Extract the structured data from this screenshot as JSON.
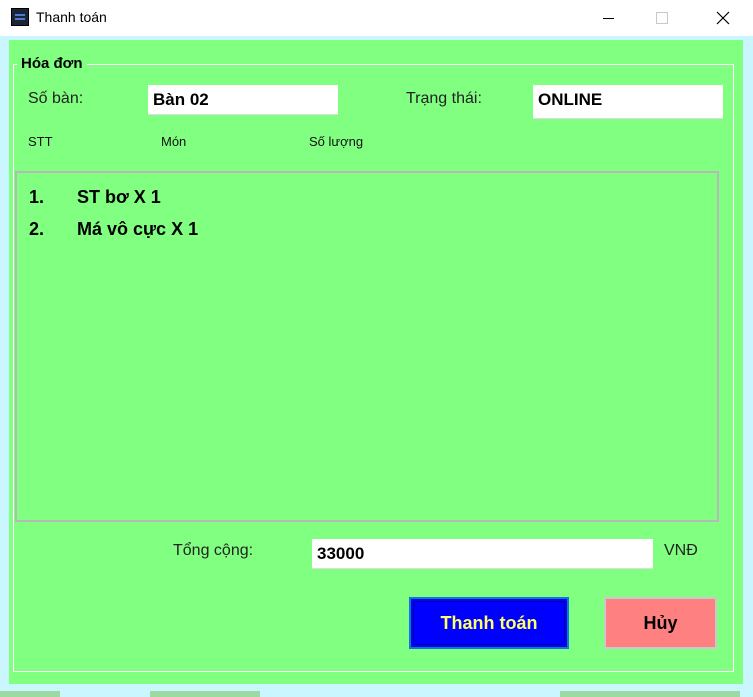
{
  "window": {
    "title": "Thanh toán",
    "controls": {
      "minimize": "minimize-icon",
      "maximize": "maximize-icon",
      "close": "close-icon"
    }
  },
  "invoice": {
    "group_title": "Hóa đơn",
    "table_label": "Số bàn:",
    "table_value": "Bàn 02",
    "status_label": "Trạng thái:",
    "status_value": "ONLINE",
    "columns": [
      "STT",
      "Món",
      "Số lượng"
    ],
    "items": [
      {
        "num": "1.",
        "text": "ST bơ  X  1"
      },
      {
        "num": "2.",
        "text": "Má vô cực  X  1"
      }
    ],
    "total_label": "Tổng cộng:",
    "total_value": "33000",
    "currency": "VNĐ"
  },
  "buttons": {
    "pay": "Thanh toán",
    "cancel": "Hủy"
  },
  "colors": {
    "form_bg": "#80ff80",
    "pay_bg": "#0000ff",
    "pay_text": "#ffff66",
    "cancel_bg": "#ff8080"
  }
}
